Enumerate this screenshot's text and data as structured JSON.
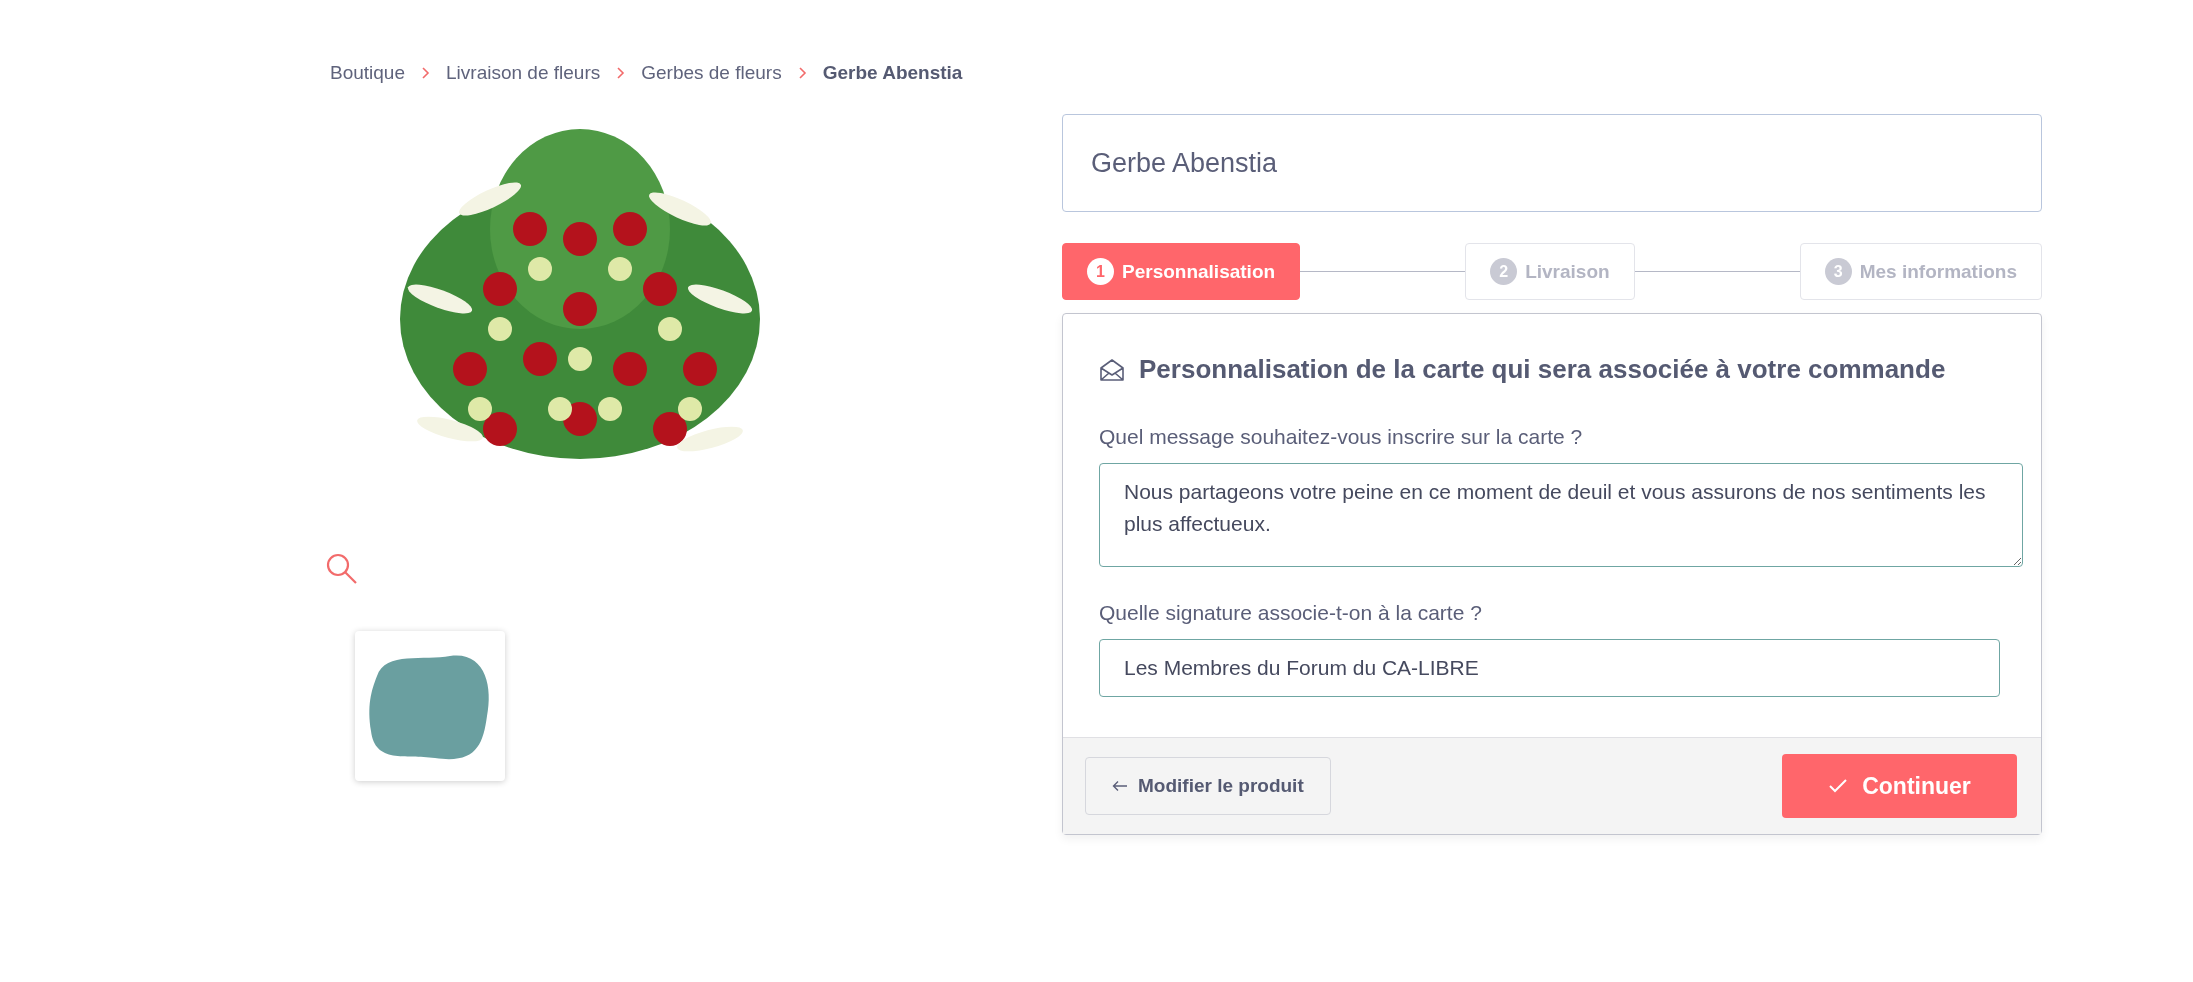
{
  "breadcrumb": [
    {
      "label": "Boutique",
      "current": false
    },
    {
      "label": "Livraison de fleurs",
      "current": false
    },
    {
      "label": "Gerbes de fleurs",
      "current": false
    },
    {
      "label": "Gerbe Abenstia",
      "current": true
    }
  ],
  "product": {
    "title": "Gerbe Abenstia"
  },
  "steps": [
    {
      "number": "1",
      "label": "Personnalisation",
      "selected": true
    },
    {
      "number": "2",
      "label": "Livraison",
      "selected": false
    },
    {
      "number": "3",
      "label": "Mes informations",
      "selected": false
    }
  ],
  "card_form": {
    "heading": "Personnalisation de la carte qui sera associée à votre commande",
    "message_label": "Quel message souhaitez-vous inscrire sur la carte ?",
    "message_value": "Nous partageons votre peine en ce moment de deuil et vous assurons de nos sentiments les plus affectueux.",
    "signature_label": "Quelle signature associe-t-on à la carte ?",
    "signature_value": "Les Membres du Forum du CA-LIBRE"
  },
  "buttons": {
    "back": "Modifier le produit",
    "continue": "Continuer"
  }
}
